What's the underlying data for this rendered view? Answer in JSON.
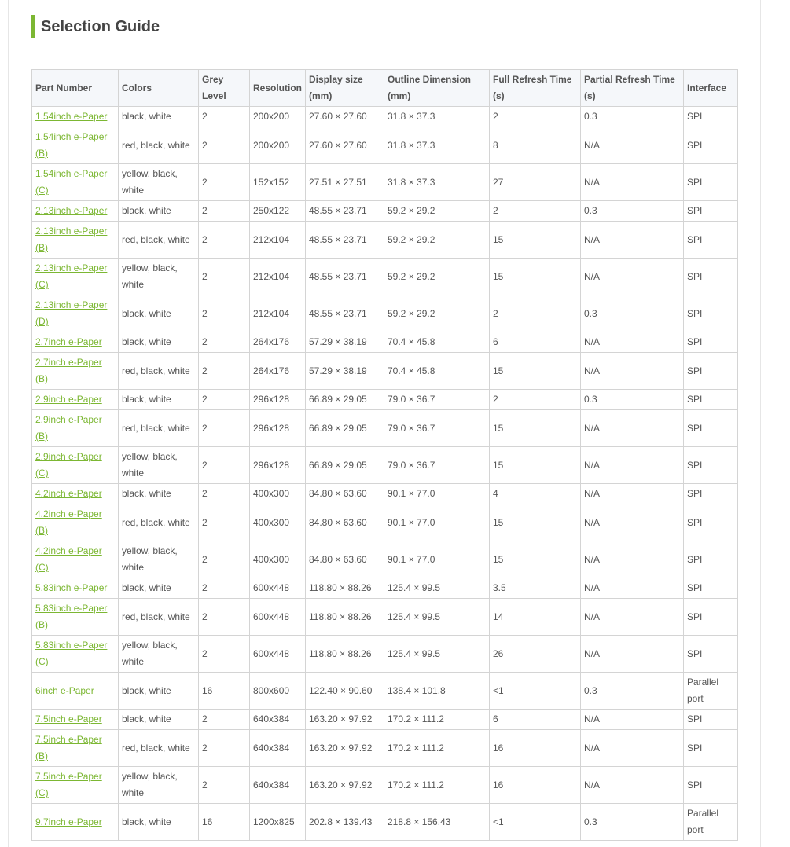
{
  "title": "Selection Guide",
  "colors": {
    "accent": "#7cb733",
    "header_bg": "#f5f7fa",
    "border": "#d4d4d4"
  },
  "headers": [
    "Part Number",
    "Colors",
    "Grey Level",
    "Resolution",
    "Display size (mm)",
    "Outline Dimension (mm)",
    "Full Refresh Time (s)",
    "Partial Refresh Time (s)",
    "Interface"
  ],
  "rows": [
    {
      "part": "1.54inch e-Paper",
      "colors": "black, white",
      "grey": "2",
      "res": "200x200",
      "display": "27.60 × 27.60",
      "outline": "31.8 × 37.3",
      "full": "2",
      "partial": "0.3",
      "iface": "SPI"
    },
    {
      "part": "1.54inch e-Paper (B)",
      "colors": "red, black, white",
      "grey": "2",
      "res": "200x200",
      "display": "27.60 × 27.60",
      "outline": "31.8 × 37.3",
      "full": "8",
      "partial": "N/A",
      "iface": "SPI"
    },
    {
      "part": "1.54inch e-Paper (C)",
      "colors": "yellow, black, white",
      "grey": "2",
      "res": "152x152",
      "display": "27.51 × 27.51",
      "outline": "31.8 × 37.3",
      "full": "27",
      "partial": "N/A",
      "iface": "SPI"
    },
    {
      "part": "2.13inch e-Paper",
      "colors": "black, white",
      "grey": "2",
      "res": "250x122",
      "display": "48.55 × 23.71",
      "outline": "59.2 × 29.2",
      "full": "2",
      "partial": "0.3",
      "iface": "SPI"
    },
    {
      "part": "2.13inch e-Paper (B)",
      "colors": "red, black, white",
      "grey": "2",
      "res": "212x104",
      "display": "48.55 × 23.71",
      "outline": "59.2 × 29.2",
      "full": "15",
      "partial": "N/A",
      "iface": "SPI"
    },
    {
      "part": "2.13inch e-Paper (C)",
      "colors": "yellow, black, white",
      "grey": "2",
      "res": "212x104",
      "display": "48.55 × 23.71",
      "outline": "59.2 × 29.2",
      "full": "15",
      "partial": "N/A",
      "iface": "SPI"
    },
    {
      "part": "2.13inch e-Paper (D)",
      "colors": "black, white",
      "grey": "2",
      "res": "212x104",
      "display": "48.55 × 23.71",
      "outline": "59.2 × 29.2",
      "full": "2",
      "partial": "0.3",
      "iface": "SPI"
    },
    {
      "part": "2.7inch e-Paper",
      "colors": "black, white",
      "grey": "2",
      "res": "264x176",
      "display": "57.29 × 38.19",
      "outline": "70.4 × 45.8",
      "full": "6",
      "partial": "N/A",
      "iface": "SPI"
    },
    {
      "part": "2.7inch e-Paper (B)",
      "colors": "red, black, white",
      "grey": "2",
      "res": "264x176",
      "display": "57.29 × 38.19",
      "outline": "70.4 × 45.8",
      "full": "15",
      "partial": "N/A",
      "iface": "SPI"
    },
    {
      "part": "2.9inch e-Paper",
      "colors": "black, white",
      "grey": "2",
      "res": "296x128",
      "display": "66.89 × 29.05",
      "outline": "79.0 × 36.7",
      "full": "2",
      "partial": "0.3",
      "iface": "SPI"
    },
    {
      "part": "2.9inch e-Paper (B)",
      "colors": "red, black, white",
      "grey": "2",
      "res": "296x128",
      "display": "66.89 × 29.05",
      "outline": "79.0 × 36.7",
      "full": "15",
      "partial": "N/A",
      "iface": "SPI"
    },
    {
      "part": "2.9inch e-Paper (C)",
      "colors": "yellow, black, white",
      "grey": "2",
      "res": "296x128",
      "display": "66.89 × 29.05",
      "outline": "79.0 × 36.7",
      "full": "15",
      "partial": "N/A",
      "iface": "SPI"
    },
    {
      "part": "4.2inch e-Paper",
      "colors": "black, white",
      "grey": "2",
      "res": "400x300",
      "display": "84.80 × 63.60",
      "outline": "90.1 × 77.0",
      "full": "4",
      "partial": "N/A",
      "iface": "SPI"
    },
    {
      "part": "4.2inch e-Paper (B)",
      "colors": "red, black, white",
      "grey": "2",
      "res": "400x300",
      "display": "84.80 × 63.60",
      "outline": "90.1 × 77.0",
      "full": "15",
      "partial": "N/A",
      "iface": "SPI"
    },
    {
      "part": "4.2inch e-Paper (C)",
      "colors": "yellow, black, white",
      "grey": "2",
      "res": "400x300",
      "display": "84.80 × 63.60",
      "outline": "90.1 × 77.0",
      "full": "15",
      "partial": "N/A",
      "iface": "SPI"
    },
    {
      "part": "5.83inch e-Paper",
      "colors": "black, white",
      "grey": "2",
      "res": "600x448",
      "display": "118.80 × 88.26",
      "outline": "125.4 × 99.5",
      "full": "3.5",
      "partial": "N/A",
      "iface": "SPI"
    },
    {
      "part": "5.83inch e-Paper (B)",
      "colors": "red, black, white",
      "grey": "2",
      "res": "600x448",
      "display": "118.80 × 88.26",
      "outline": "125.4 × 99.5",
      "full": "14",
      "partial": "N/A",
      "iface": "SPI"
    },
    {
      "part": "5.83inch e-Paper (C)",
      "colors": "yellow, black, white",
      "grey": "2",
      "res": "600x448",
      "display": "118.80 × 88.26",
      "outline": "125.4 × 99.5",
      "full": "26",
      "partial": "N/A",
      "iface": "SPI"
    },
    {
      "part": "6inch e-Paper",
      "colors": "black, white",
      "grey": "16",
      "res": "800x600",
      "display": "122.40 × 90.60",
      "outline": "138.4 × 101.8",
      "full": "<1",
      "partial": "0.3",
      "iface": "Parallel port"
    },
    {
      "part": "7.5inch e-Paper",
      "colors": "black, white",
      "grey": "2",
      "res": "640x384",
      "display": "163.20 × 97.92",
      "outline": "170.2 × 111.2",
      "full": "6",
      "partial": "N/A",
      "iface": "SPI"
    },
    {
      "part": "7.5inch e-Paper (B)",
      "colors": "red, black, white",
      "grey": "2",
      "res": "640x384",
      "display": "163.20 × 97.92",
      "outline": "170.2 × 111.2",
      "full": "16",
      "partial": "N/A",
      "iface": "SPI"
    },
    {
      "part": "7.5inch e-Paper (C)",
      "colors": "yellow, black, white",
      "grey": "2",
      "res": "640x384",
      "display": "163.20 × 97.92",
      "outline": "170.2 × 111.2",
      "full": "16",
      "partial": "N/A",
      "iface": "SPI"
    },
    {
      "part": "9.7inch e-Paper",
      "colors": "black, white",
      "grey": "16",
      "res": "1200x825",
      "display": "202.8 × 139.43",
      "outline": "218.8 × 156.43",
      "full": "<1",
      "partial": "0.3",
      "iface": "Parallel port"
    }
  ]
}
